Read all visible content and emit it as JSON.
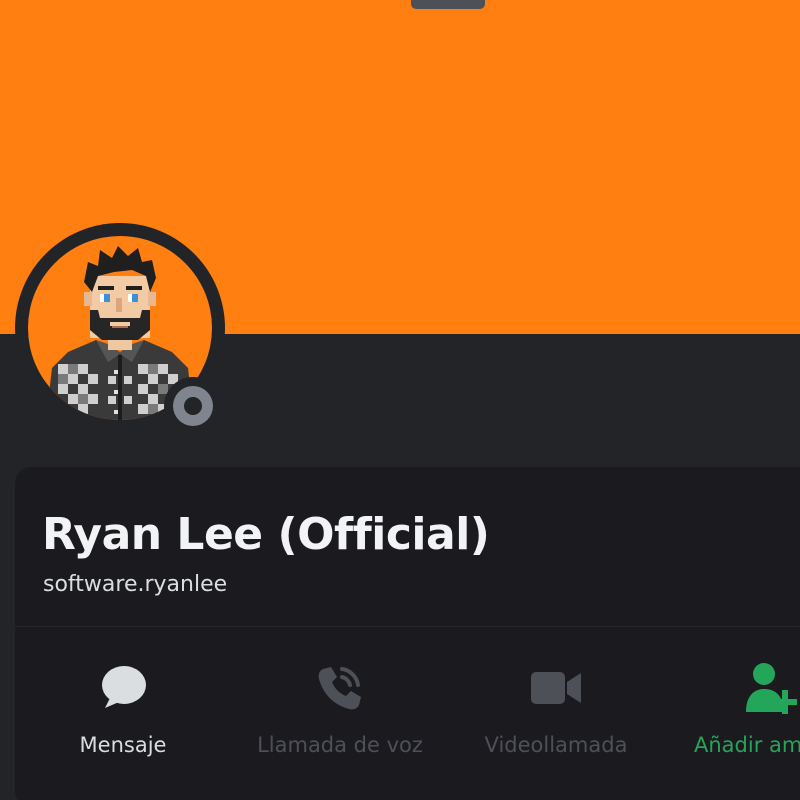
{
  "colors": {
    "banner": "#ff7f11",
    "avatar_background": "#ff7f11",
    "status_offline": "#80848e",
    "card_background": "#1b1b1f",
    "page_background": "#232428",
    "add_friend_green": "#23a55a",
    "disabled_text": "#4e5058"
  },
  "profile": {
    "display_name": "Ryan Lee (Official)",
    "username": "software.ryanlee",
    "status": "offline"
  },
  "actions": [
    {
      "label": "Mensaje",
      "icon": "chat-bubble-icon",
      "enabled": true
    },
    {
      "label": "Llamada de voz",
      "icon": "phone-call-icon",
      "enabled": false
    },
    {
      "label": "Videollamada",
      "icon": "video-camera-icon",
      "enabled": false
    },
    {
      "label": "Añadir amigo",
      "icon": "add-friend-icon",
      "enabled": true
    }
  ]
}
